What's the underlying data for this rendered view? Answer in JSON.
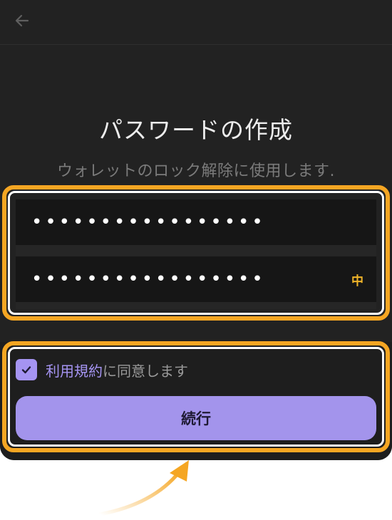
{
  "header": {
    "back_icon": "arrow-left-icon"
  },
  "main": {
    "title": "パスワードの作成",
    "subtitle": "ウォレットのロック解除に使用します."
  },
  "password_fields": [
    {
      "value": "•••••••••••••••••",
      "placeholder": ""
    },
    {
      "value": "•••••••••••••••••",
      "placeholder": "",
      "strength_label": "中"
    }
  ],
  "agreement": {
    "checked": true,
    "terms_link": "利用規約",
    "suffix": "に同意します"
  },
  "continue_button": {
    "label": "続行"
  },
  "colors": {
    "background": "#222222",
    "accent": "#a594f2",
    "strength": "#f0b429",
    "highlight": "#f5a623"
  }
}
